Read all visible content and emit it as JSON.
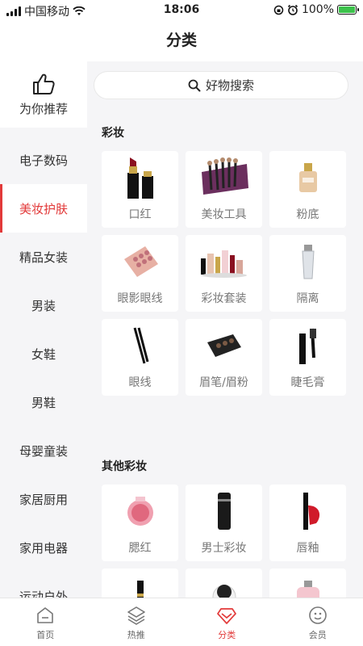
{
  "status_bar": {
    "carrier": "中国移动",
    "time": "18:06",
    "battery": "100%"
  },
  "header": {
    "title": "分类"
  },
  "sidebar": {
    "items": [
      {
        "label": "为你推荐",
        "icon": "thumbs-up-icon"
      },
      {
        "label": "电子数码"
      },
      {
        "label": "美妆护肤"
      },
      {
        "label": "精品女装"
      },
      {
        "label": "男装"
      },
      {
        "label": "女鞋"
      },
      {
        "label": "男鞋"
      },
      {
        "label": "母婴童装"
      },
      {
        "label": "家居厨用"
      },
      {
        "label": "家用电器"
      },
      {
        "label": "运动户外"
      }
    ],
    "active_index": 2
  },
  "search": {
    "placeholder": "好物搜索",
    "icon": "search-icon"
  },
  "sections": [
    {
      "title": "彩妆",
      "items": [
        {
          "label": "口红"
        },
        {
          "label": "美妆工具"
        },
        {
          "label": "粉底"
        },
        {
          "label": "眼影眼线"
        },
        {
          "label": "彩妆套装"
        },
        {
          "label": "隔离"
        },
        {
          "label": "眼线"
        },
        {
          "label": "眉笔/眉粉"
        },
        {
          "label": "睫毛膏"
        }
      ]
    },
    {
      "title": "其他彩妆",
      "items": [
        {
          "label": "腮红"
        },
        {
          "label": "男士彩妆"
        },
        {
          "label": "唇釉"
        }
      ]
    }
  ],
  "tabbar": {
    "items": [
      {
        "label": "首页",
        "icon": "home-icon"
      },
      {
        "label": "热推",
        "icon": "layers-icon"
      },
      {
        "label": "分类",
        "icon": "diamond-icon"
      },
      {
        "label": "会员",
        "icon": "member-icon"
      }
    ],
    "active_index": 2
  },
  "colors": {
    "accent": "#e23a3a",
    "background": "#f5f5f7"
  }
}
